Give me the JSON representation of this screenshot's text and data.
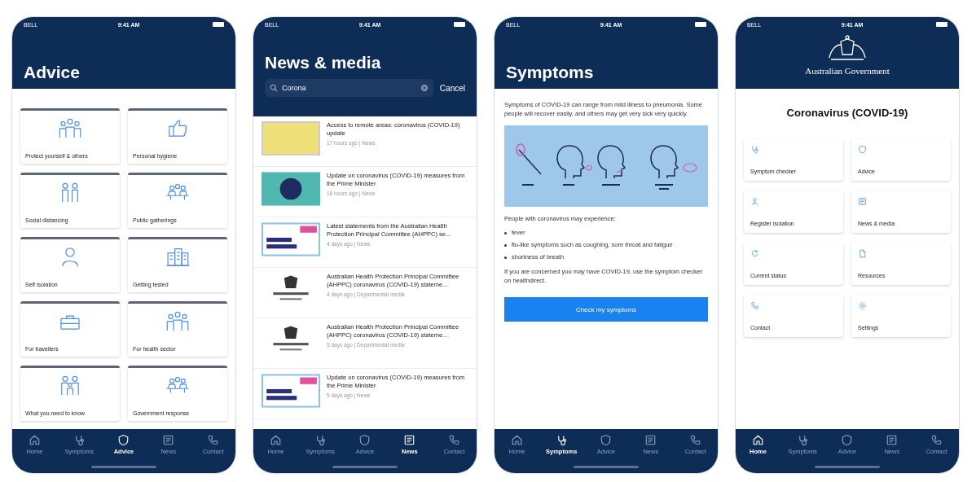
{
  "phones": [
    {
      "kind": "advice",
      "status": {
        "carrier": "BELL",
        "time": "9:41 AM"
      },
      "title": "Advice",
      "tiles": [
        {
          "label": "Protect yourself & others",
          "kind": "group"
        },
        {
          "label": "Personal hygiene",
          "kind": "thumb"
        },
        {
          "label": "Social distancing",
          "kind": "pair"
        },
        {
          "label": "Public gatherings",
          "kind": "crowd"
        },
        {
          "label": "Self isolation",
          "kind": "person"
        },
        {
          "label": "Getting tested",
          "kind": "building"
        },
        {
          "label": "For travellers",
          "kind": "travel"
        },
        {
          "label": "For health sector",
          "kind": "group"
        },
        {
          "label": "What you need to know",
          "kind": "family"
        },
        {
          "label": "Government response",
          "kind": "crowd"
        }
      ],
      "tabs": [
        {
          "label": "Home",
          "kind": "home",
          "selected": false
        },
        {
          "label": "Symptoms",
          "kind": "symptoms",
          "selected": false
        },
        {
          "label": "Advice",
          "kind": "advice",
          "selected": true
        },
        {
          "label": "News",
          "kind": "news",
          "selected": false
        },
        {
          "label": "Contact",
          "kind": "contact",
          "selected": false
        }
      ]
    },
    {
      "kind": "news",
      "status": {
        "carrier": "BELL",
        "time": "9:41 AM"
      },
      "title": "News & media",
      "search": {
        "value": "Corona",
        "action": "Cancel"
      },
      "items": [
        {
          "title": "Access to remote areas: coronavirus (COVID-19) update",
          "meta": "17 hours ago | News",
          "kind": "photo"
        },
        {
          "title": "Update on coronavirus (COVID-19) measures from the Prime Minister",
          "meta": "18 hours ago | News",
          "kind": "logo"
        },
        {
          "title": "Latest statements from the Australian Health Protection Principal Committee (AHPPC) se...",
          "meta": "4 days ago | News",
          "kind": "statement"
        },
        {
          "title": "Australian Health Protection Principal Committee (AHPPC) coronavirus (COVID-19) stateme...",
          "meta": "4 days ago | Departmental media",
          "kind": "crest"
        },
        {
          "title": "Australian Health Protection Principal Committee (AHPPC) coronavirus (COVID-19) stateme...",
          "meta": "5 days ago | Departmental media",
          "kind": "crest"
        },
        {
          "title": "Update on coronavirus (COVID-19) measures from the Prime Minister",
          "meta": "5 days ago | News",
          "kind": "statement"
        }
      ],
      "tabs": [
        {
          "label": "Home",
          "kind": "home",
          "selected": false
        },
        {
          "label": "Symptoms",
          "kind": "symptoms",
          "selected": false
        },
        {
          "label": "Advice",
          "kind": "advice",
          "selected": false
        },
        {
          "label": "News",
          "kind": "news",
          "selected": true
        },
        {
          "label": "Contact",
          "kind": "contact",
          "selected": false
        }
      ]
    },
    {
      "kind": "symptoms",
      "status": {
        "carrier": "BELL",
        "time": "9:41 AM"
      },
      "title": "Symptoms",
      "intro": "Symptoms of COVID-19 can range from mild illness to pneumonia. Some people will recover easily, and others may get very sick very quickly.",
      "lead": "People with coronavirus may experience:",
      "bullets": [
        "fever",
        "flu-like symptoms such as coughing, sore throat and fatigue",
        "shortness of breath"
      ],
      "outro": "If you are concerned you may have COVID-19, use the symptom checker on healthdirect.",
      "button": "Check my symptoms",
      "tabs": [
        {
          "label": "Home",
          "kind": "home",
          "selected": false
        },
        {
          "label": "Symptoms",
          "kind": "symptoms",
          "selected": true
        },
        {
          "label": "Advice",
          "kind": "advice",
          "selected": false
        },
        {
          "label": "News",
          "kind": "news",
          "selected": false
        },
        {
          "label": "Contact",
          "kind": "contact",
          "selected": false
        }
      ]
    },
    {
      "kind": "home",
      "status": {
        "carrier": "BELL",
        "time": "9:41 AM"
      },
      "brand": "Australian Government",
      "heading": "Coronavirus (COVID-19)",
      "tiles": [
        {
          "label": "Symptom checker",
          "kind": "symptoms"
        },
        {
          "label": "Advice",
          "kind": "advice"
        },
        {
          "label": "Register isolation",
          "kind": "register"
        },
        {
          "label": "News & media",
          "kind": "news"
        },
        {
          "label": "Current status",
          "kind": "status"
        },
        {
          "label": "Resources",
          "kind": "resources"
        },
        {
          "label": "Contact",
          "kind": "contact"
        },
        {
          "label": "Settings",
          "kind": "settings"
        }
      ],
      "tabs": [
        {
          "label": "Home",
          "kind": "home",
          "selected": true
        },
        {
          "label": "Symptoms",
          "kind": "symptoms",
          "selected": false
        },
        {
          "label": "Advice",
          "kind": "advice",
          "selected": false
        },
        {
          "label": "News",
          "kind": "news",
          "selected": false
        },
        {
          "label": "Contact",
          "kind": "contact",
          "selected": false
        }
      ]
    }
  ]
}
